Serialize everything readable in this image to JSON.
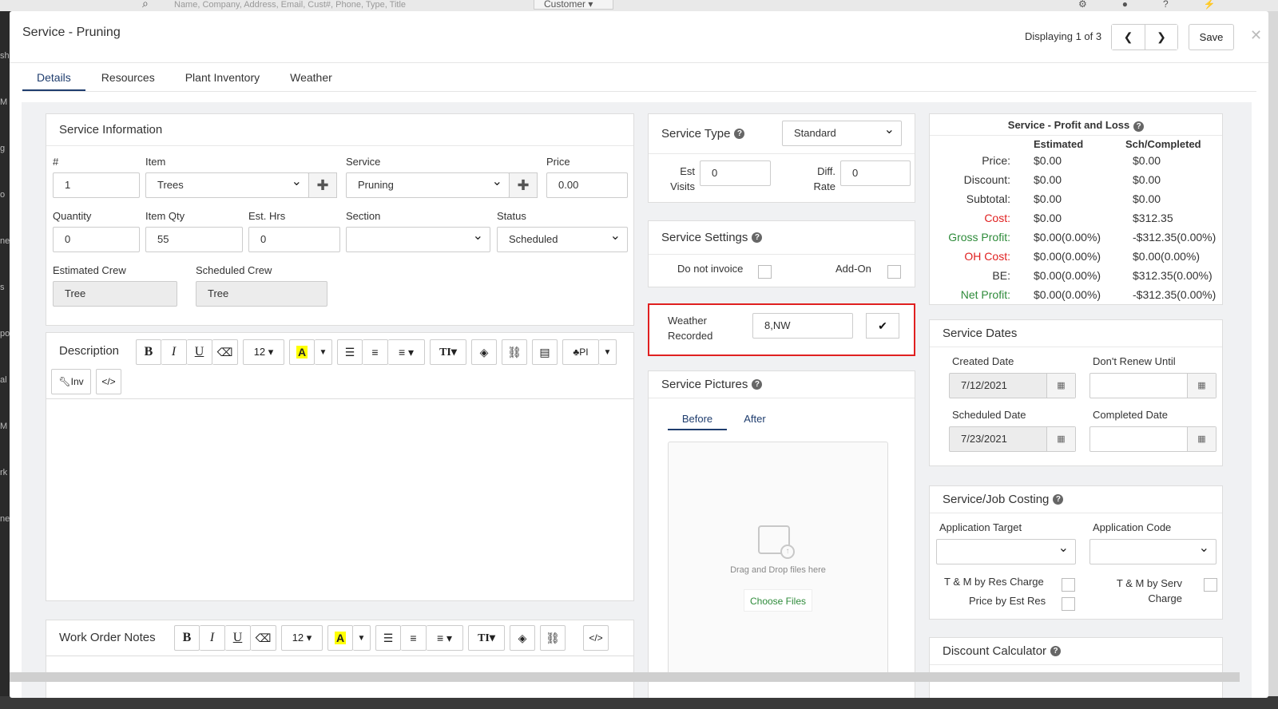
{
  "background": {
    "search_placeholder": "Name, Company, Address, Email, Cust#, Phone, Type, Title",
    "customer_dropdown": "Customer",
    "left_letters": [
      "sh",
      "M",
      "g",
      "o",
      "ne",
      "s",
      "po",
      "al",
      "M",
      "rk",
      "ne"
    ]
  },
  "modal": {
    "title": "Service - Pruning",
    "pager_label": "Displaying 1 of 3",
    "prev_glyph": "❮",
    "next_glyph": "❯",
    "save_label": "Save",
    "close_glyph": "✕"
  },
  "tabs": [
    "Details",
    "Resources",
    "Plant Inventory",
    "Weather"
  ],
  "service_info": {
    "title": "Service Information",
    "labels": {
      "number": "#",
      "item": "Item",
      "service": "Service",
      "price": "Price",
      "quantity": "Quantity",
      "item_qty": "Item Qty",
      "est_hrs": "Est. Hrs",
      "section": "Section",
      "status": "Status",
      "estimated_crew": "Estimated Crew",
      "scheduled_crew": "Scheduled Crew"
    },
    "values": {
      "number": "1",
      "item": "Trees",
      "service": "Pruning",
      "price": "0.00",
      "quantity": "0",
      "item_qty": "55",
      "est_hrs": "0",
      "section": "",
      "status": "Scheduled",
      "estimated_crew": "Tree",
      "scheduled_crew": "Tree"
    },
    "plus_glyph": "✚"
  },
  "description": {
    "title": "Description",
    "font_size": "12 ▾",
    "inv_label": "Inv",
    "pi_label": "PI"
  },
  "work_order": {
    "title": "Work Order Notes",
    "font_size": "12 ▾"
  },
  "service_type": {
    "title": "Service Type",
    "value": "Standard",
    "est_visits_label": "Est\nVisits",
    "est_visits_value": "0",
    "diff_rate_label": "Diff.\nRate",
    "diff_rate_value": "0"
  },
  "service_settings": {
    "title": "Service Settings",
    "do_not_invoice": "Do not invoice",
    "add_on": "Add-On"
  },
  "weather": {
    "label": "Weather\nRecorded",
    "value": "8,NW",
    "check_glyph": "✔",
    "highlight_color": "#e02020"
  },
  "pictures": {
    "title": "Service Pictures",
    "tab_before": "Before",
    "tab_after": "After",
    "drop_text": "Drag and Drop files here",
    "choose_files": "Choose Files",
    "choose_color": "#2e8b3a"
  },
  "profit_loss": {
    "title": "Service - Profit and Loss",
    "col_estimated": "Estimated",
    "col_completed": "Sch/Completed",
    "rows": [
      {
        "label": "Price:",
        "est": "$0.00",
        "sch": "$0.00",
        "color": "#333333"
      },
      {
        "label": "Discount:",
        "est": "$0.00",
        "sch": "$0.00",
        "color": "#333333"
      },
      {
        "label": "Subtotal:",
        "est": "$0.00",
        "sch": "$0.00",
        "color": "#333333"
      },
      {
        "label": "Cost:",
        "est": "$0.00",
        "sch": "$312.35",
        "color": "#e02020"
      },
      {
        "label": "Gross Profit:",
        "est": "$0.00(0.00%)",
        "sch": "-$312.35(0.00%)",
        "color": "#2e8b3a"
      },
      {
        "label": "OH Cost:",
        "est": "$0.00(0.00%)",
        "sch": "$0.00(0.00%)",
        "color": "#e02020"
      },
      {
        "label": "BE:",
        "est": "$0.00(0.00%)",
        "sch": "$312.35(0.00%)",
        "color": "#333333"
      },
      {
        "label": "Net Profit:",
        "est": "$0.00(0.00%)",
        "sch": "-$312.35(0.00%)",
        "color": "#2e8b3a"
      }
    ]
  },
  "service_dates": {
    "title": "Service Dates",
    "created_label": "Created Date",
    "created_value": "7/12/2021",
    "dont_renew_label": "Don't Renew Until",
    "dont_renew_value": "",
    "scheduled_label": "Scheduled Date",
    "scheduled_value": "7/23/2021",
    "completed_label": "Completed Date",
    "completed_value": ""
  },
  "job_costing": {
    "title": "Service/Job Costing",
    "app_target_label": "Application Target",
    "app_code_label": "Application Code",
    "tm_res_charge": "T & M by Res Charge",
    "price_est_res": "Price by Est Res",
    "tm_serv_charge": "T & M by Serv\nCharge"
  },
  "discount_calc": {
    "title": "Discount Calculator"
  }
}
